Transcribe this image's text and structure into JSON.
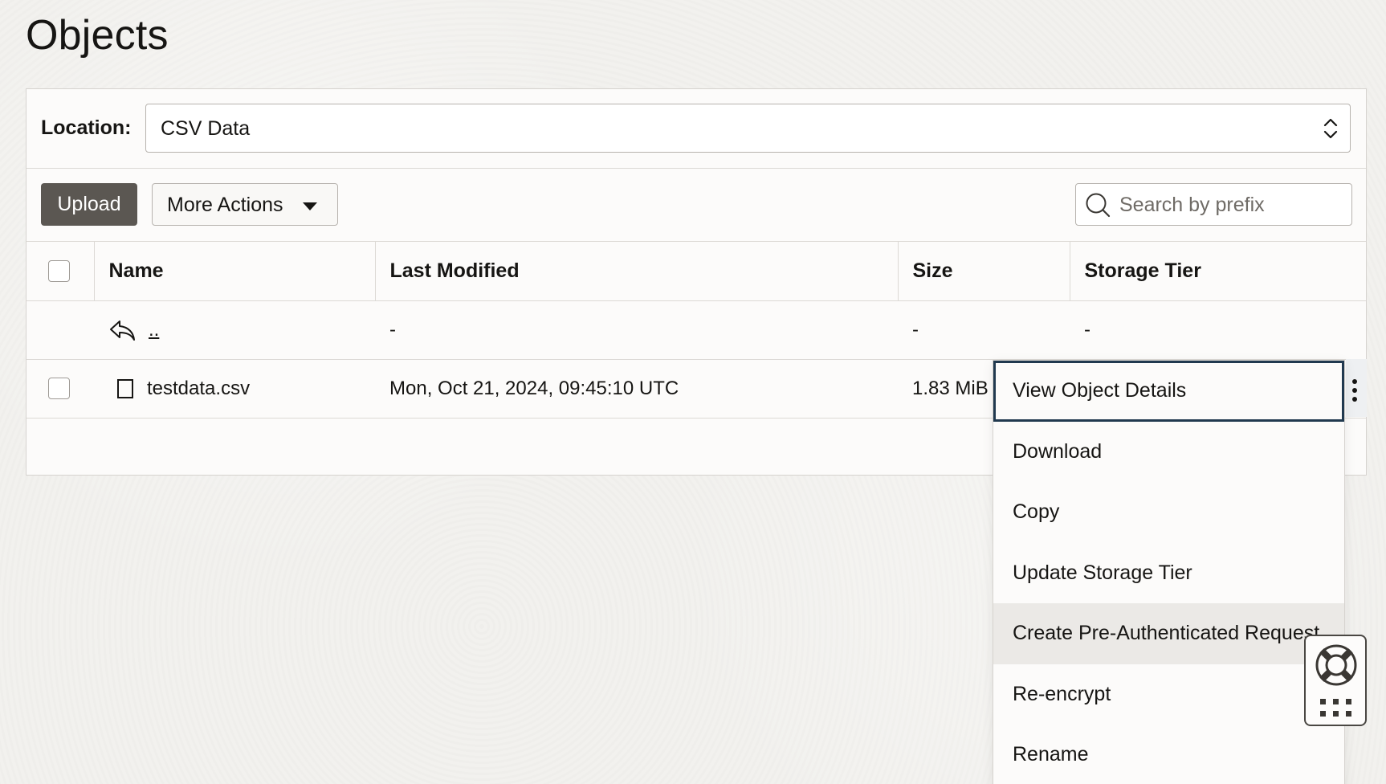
{
  "page": {
    "title": "Objects"
  },
  "location": {
    "label": "Location:",
    "value": "CSV Data"
  },
  "toolbar": {
    "upload_label": "Upload",
    "more_actions_label": "More Actions",
    "search_placeholder": "Search by prefix"
  },
  "table": {
    "headers": {
      "name": "Name",
      "last_modified": "Last Modified",
      "size": "Size",
      "storage_tier": "Storage Tier"
    },
    "rows": [
      {
        "name": "..",
        "last_modified": "-",
        "size": "-",
        "storage_tier": "-",
        "icon": "back-arrow-icon"
      },
      {
        "name": "testdata.csv",
        "last_modified": "Mon, Oct 21, 2024, 09:45:10 UTC",
        "size": "1.83 MiB",
        "storage_tier": "",
        "icon": "file-icon"
      }
    ]
  },
  "context_menu": {
    "items": [
      {
        "label": "View Object Details"
      },
      {
        "label": "Download"
      },
      {
        "label": "Copy"
      },
      {
        "label": "Update Storage Tier"
      },
      {
        "label": "Create Pre-Authenticated Request"
      },
      {
        "label": "Re-encrypt"
      },
      {
        "label": "Rename"
      }
    ]
  },
  "colors": {
    "primary_button": "#5b5752",
    "focus_outline": "#21394f",
    "panel_bg": "#fcfbfa",
    "page_bg": "#f2f1ee"
  },
  "icons": [
    "updown-icon",
    "caret-down-icon",
    "search-icon",
    "back-arrow-icon",
    "file-icon",
    "kebab-menu-icon",
    "lifebuoy-icon",
    "grid-icon"
  ]
}
